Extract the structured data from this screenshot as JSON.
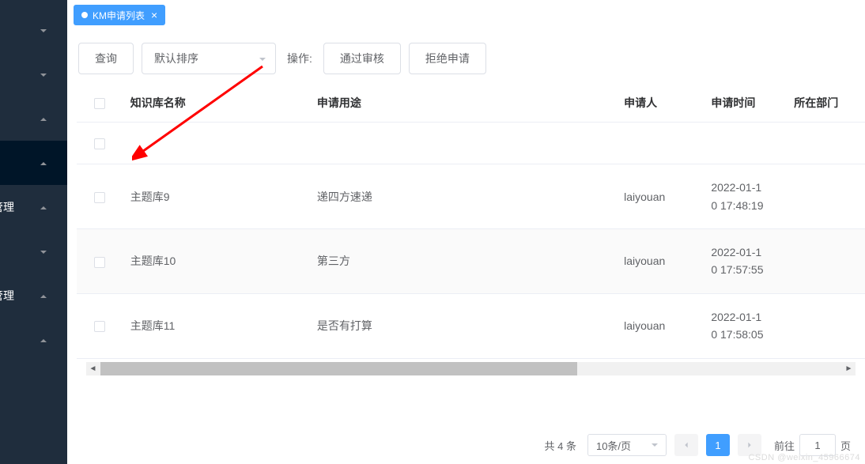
{
  "sidebar": {
    "items": [
      {
        "label": "",
        "dir": "down"
      },
      {
        "label": "",
        "dir": "down"
      },
      {
        "label": "",
        "dir": "up"
      },
      {
        "label": "",
        "dir": "up"
      },
      {
        "label": "管理",
        "dir": "up"
      },
      {
        "label": "",
        "dir": "down"
      },
      {
        "label": "管理",
        "dir": "up"
      },
      {
        "label": "",
        "dir": "up"
      }
    ]
  },
  "tabs": {
    "active": {
      "label": "KM申请列表"
    }
  },
  "toolbar": {
    "query_label": "查询",
    "sort_select_value": "默认排序",
    "ops_label": "操作:",
    "approve_label": "通过审核",
    "reject_label": "拒绝申请"
  },
  "table": {
    "headers": {
      "name": "知识库名称",
      "purpose": "申请用途",
      "applicant": "申请人",
      "time": "申请时间",
      "dept": "所在部门"
    },
    "rows": [
      {
        "name": "",
        "purpose": "",
        "applicant": "",
        "time_line1": "",
        "time_line2": "",
        "dept": ""
      },
      {
        "name": "主题库9",
        "purpose": "递四方速递",
        "applicant": "laiyouan",
        "time_line1": "2022-01-1",
        "time_line2": "0 17:48:19",
        "dept": ""
      },
      {
        "name": "主题库10",
        "purpose": "第三方",
        "applicant": "laiyouan",
        "time_line1": "2022-01-1",
        "time_line2": "0 17:57:55",
        "dept": ""
      },
      {
        "name": "主题库11",
        "purpose": "是否有打算",
        "applicant": "laiyouan",
        "time_line1": "2022-01-1",
        "time_line2": "0 17:58:05",
        "dept": ""
      }
    ]
  },
  "pagination": {
    "total_label": "共 4 条",
    "page_size_label": "10条/页",
    "current_page": "1",
    "jump_prefix": "前往",
    "jump_input": "1",
    "jump_suffix": "页"
  },
  "watermark": "CSDN @weixin_45966674"
}
